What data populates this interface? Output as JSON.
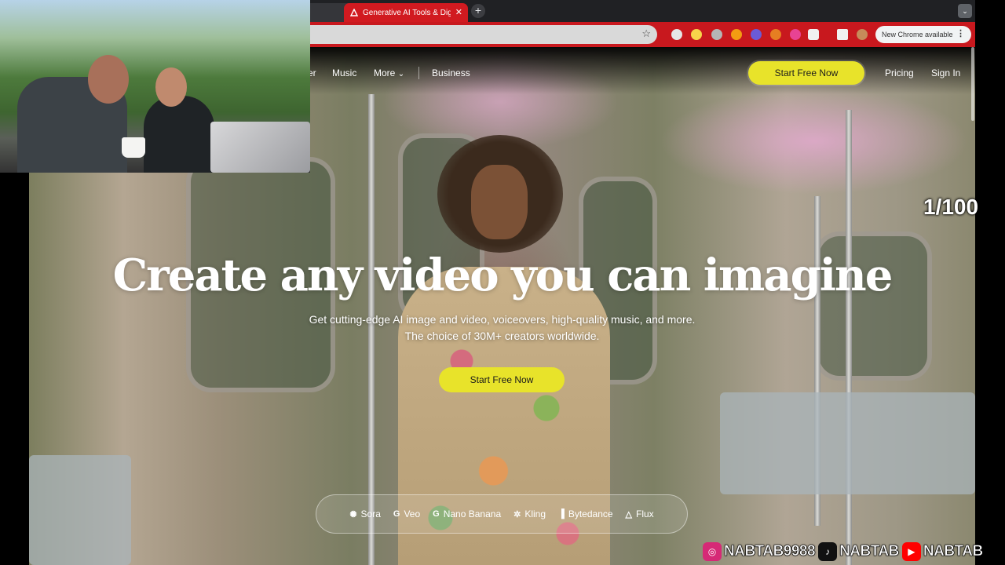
{
  "browser": {
    "tabs": [
      {
        "title": "",
        "active": false
      },
      {
        "title": "Generative AI Tools & Digital",
        "active": true
      }
    ],
    "new_tab_label": "+",
    "tab_search_label": "⌄",
    "update_button_label": "New Chrome available",
    "colors": {
      "theme": "#c8181e",
      "tab_active": "#d11a20"
    }
  },
  "site": {
    "nav": {
      "links": [
        "er",
        "Music",
        "More",
        "Business"
      ],
      "more_chevron": "⌄",
      "cta": "Start Free Now",
      "pricing": "Pricing",
      "signin": "Sign In"
    },
    "hero": {
      "title": "Create any video you can imagine",
      "subtitle_1": "Get cutting-edge AI image and video, voiceovers, high-quality music, and more.",
      "subtitle_2": "The choice of 30M+ creators worldwide.",
      "cta": "Start Free Now"
    },
    "models": [
      {
        "icon": "✺",
        "label": "Sora"
      },
      {
        "icon": "G",
        "label": "Veo"
      },
      {
        "icon": "G",
        "label": "Nano Banana"
      },
      {
        "icon": "✲",
        "label": "Kling"
      },
      {
        "icon": "▐",
        "label": "Bytedance"
      },
      {
        "icon": "△",
        "label": "Flux"
      }
    ],
    "colors": {
      "accent": "#e8e32a"
    }
  },
  "overlay": {
    "counter": "1/100",
    "social": [
      {
        "icon": "instagram-icon",
        "glyph": "◎",
        "handle": "NABTAB9988",
        "color": "#d62976"
      },
      {
        "icon": "tiktok-icon",
        "glyph": "♪",
        "handle": "NABTAB",
        "color": "#111111"
      },
      {
        "icon": "youtube-icon",
        "glyph": "▶",
        "handle": "NABTAB",
        "color": "#ff0000"
      }
    ]
  }
}
